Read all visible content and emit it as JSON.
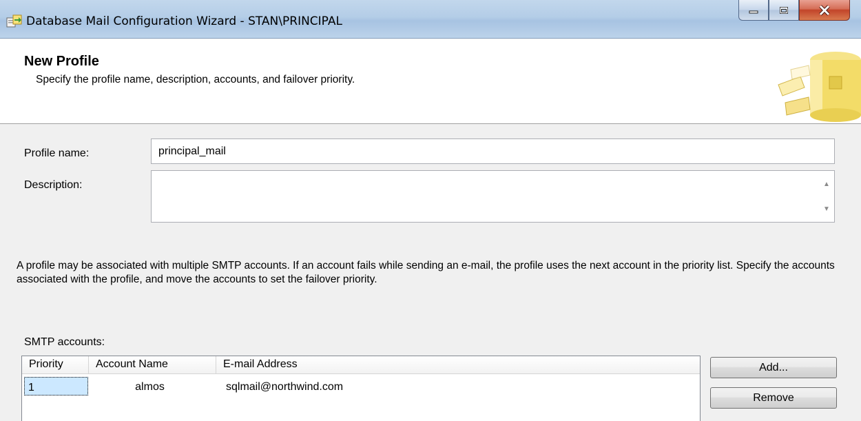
{
  "window": {
    "title": "Database Mail Configuration Wizard - STAN\\PRINCIPAL",
    "app_icon": "wizard-icon",
    "controls": [
      "minimize-icon",
      "maximize-icon",
      "close-icon"
    ]
  },
  "header": {
    "title": "New Profile",
    "subtitle": "Specify the profile name, description, accounts, and failover priority.",
    "icon": "database-mail-icon"
  },
  "form": {
    "profile_name_label": "Profile name:",
    "profile_name_value": "principal_mail",
    "description_label": "Description:",
    "description_value": ""
  },
  "info_text": "A profile may be associated with multiple SMTP accounts. If an account fails while sending an e-mail, the profile uses the next account in the priority list. Specify the accounts associated with the profile, and move the accounts to set the failover priority.",
  "smtp": {
    "label": "SMTP accounts:",
    "columns": [
      "Priority",
      "Account Name",
      "E-mail Address"
    ],
    "rows": [
      {
        "priority": "1",
        "account_name": "almos",
        "email": "sqlmail@northwind.com"
      }
    ],
    "add_label": "Add...",
    "remove_label": "Remove"
  },
  "colors": {
    "titlebar": "#b4cde7",
    "selection": "#cce8ff",
    "close_button": "#c2442a"
  }
}
